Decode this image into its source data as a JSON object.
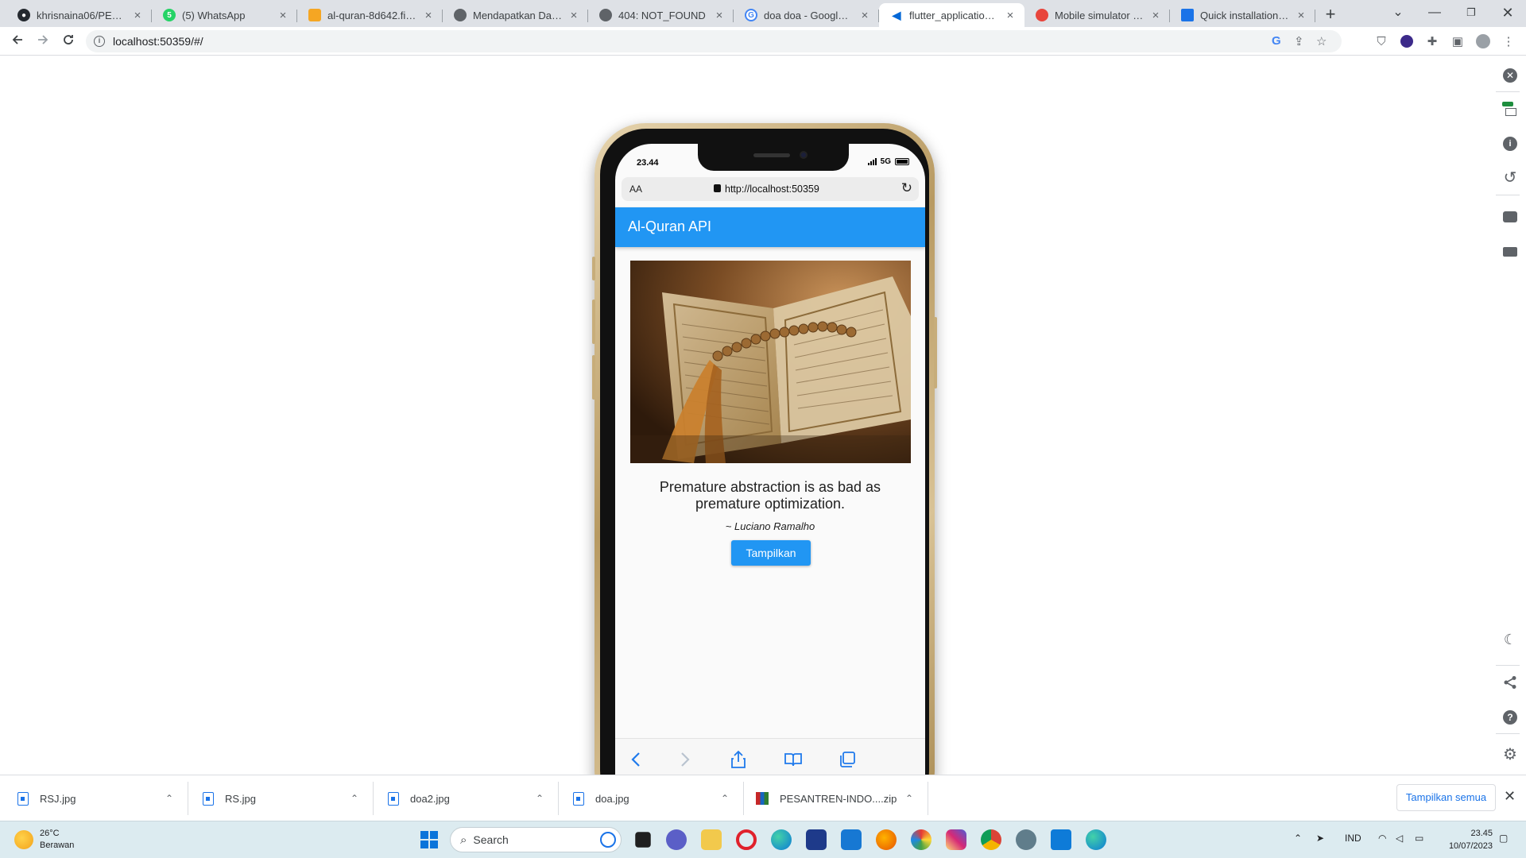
{
  "browser": {
    "tabs": [
      {
        "label": "khrisnaina06/PESANTREN",
        "favicon": "github-icon",
        "color": "#24292f"
      },
      {
        "label": "(5) WhatsApp",
        "favicon": "whatsapp-icon",
        "color": "#25d366"
      },
      {
        "label": "al-quran-8d642.firebase",
        "favicon": "firebase-icon",
        "color": "#f5a623"
      },
      {
        "label": "Mendapatkan Data API",
        "favicon": "globe-icon",
        "color": "#5f6368"
      },
      {
        "label": "404: NOT_FOUND",
        "favicon": "globe-icon",
        "color": "#5f6368"
      },
      {
        "label": "doa doa - Google Penelusuran",
        "favicon": "google-icon",
        "color": "#4285f4"
      },
      {
        "label": "flutter_application_1",
        "favicon": "flutter-icon",
        "color": "#0468d7",
        "active": true
      },
      {
        "label": "Mobile simulator - responsive",
        "favicon": "simulator-icon",
        "color": "#e8453c"
      },
      {
        "label": "Quick installation of the",
        "favicon": "docs-icon",
        "color": "#1a73e8"
      }
    ],
    "url": "localhost:50359/#/"
  },
  "phone": {
    "status_time": "23.44",
    "network": "5G",
    "safari_aa": "AA",
    "safari_url": "http://localhost:50359"
  },
  "app": {
    "title": "Al-Quran API",
    "quote": "Premature abstraction is as bad as premature optimization.",
    "author": "~ Luciano Ramalho",
    "button": "Tampilkan"
  },
  "downloads": {
    "items": [
      {
        "name": "RSJ.jpg"
      },
      {
        "name": "RS.jpg"
      },
      {
        "name": "doa2.jpg"
      },
      {
        "name": "doa.jpg"
      },
      {
        "name": "PESANTREN-INDO....zip"
      }
    ],
    "show_all": "Tampilkan semua"
  },
  "taskbar": {
    "temp": "26°C",
    "weather": "Berawan",
    "search": "Search",
    "lang": "IND",
    "time": "23.45",
    "date": "10/07/2023"
  },
  "colors": {
    "appbar": "#2196f3",
    "button": "#2196f3",
    "tabstrip": "#dee1e6"
  }
}
